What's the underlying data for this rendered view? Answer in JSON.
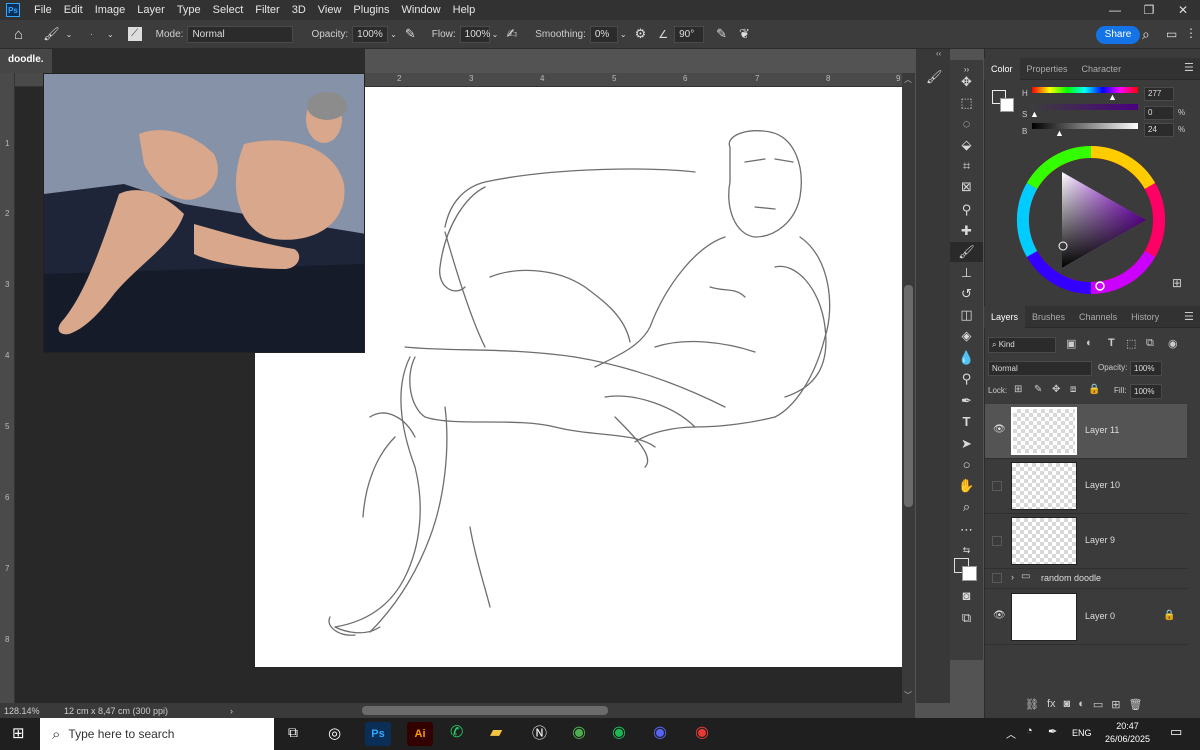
{
  "menubar": {
    "logo": "Ps",
    "items": [
      "File",
      "Edit",
      "Image",
      "Layer",
      "Type",
      "Select",
      "Filter",
      "3D",
      "View",
      "Plugins",
      "Window",
      "Help"
    ]
  },
  "options": {
    "mode_label": "Mode:",
    "mode_value": "Normal",
    "opacity_label": "Opacity:",
    "opacity_value": "100%",
    "flow_label": "Flow:",
    "flow_value": "100%",
    "smoothing_label": "Smoothing:",
    "smoothing_value": "0%",
    "angle_value": "90°",
    "share_label": "Share"
  },
  "document": {
    "tab_name": "doodle.",
    "zoom": "128.14%",
    "doc_info": "12 cm x 8,47 cm (300 ppi)"
  },
  "rulers": {
    "top": [
      "2",
      "3",
      "4",
      "5",
      "6",
      "7",
      "8",
      "9"
    ],
    "left": [
      "1",
      "2",
      "3",
      "4",
      "5",
      "6",
      "7",
      "8"
    ]
  },
  "color_panel": {
    "tabs": [
      "Color",
      "Properties",
      "Character"
    ],
    "h_label": "H",
    "h_value": "277",
    "s_label": "S",
    "s_value": "0",
    "b_label": "B",
    "b_value": "24",
    "percent": "%"
  },
  "layers_panel": {
    "tabs": [
      "Layers",
      "Brushes",
      "Channels",
      "History"
    ],
    "kind_label": "Kind",
    "blend_mode": "Normal",
    "opacity_label": "Opacity:",
    "opacity_value": "100%",
    "lock_label": "Lock:",
    "fill_label": "Fill:",
    "fill_value": "100%",
    "layers": [
      {
        "name": "Layer 11"
      },
      {
        "name": "Layer 10"
      },
      {
        "name": "Layer 9"
      },
      {
        "name": "random doodle"
      },
      {
        "name": "Layer 0"
      }
    ]
  },
  "taskbar": {
    "search_placeholder": "Type here to search",
    "apps": [
      "Ps",
      "Ai"
    ],
    "language": "ENG",
    "time": "20:47",
    "date": "26/06/2025"
  },
  "colors": {
    "accent": "#1473e6",
    "ps_blue": "#31a8ff",
    "ai_orange": "#ff9a00"
  }
}
